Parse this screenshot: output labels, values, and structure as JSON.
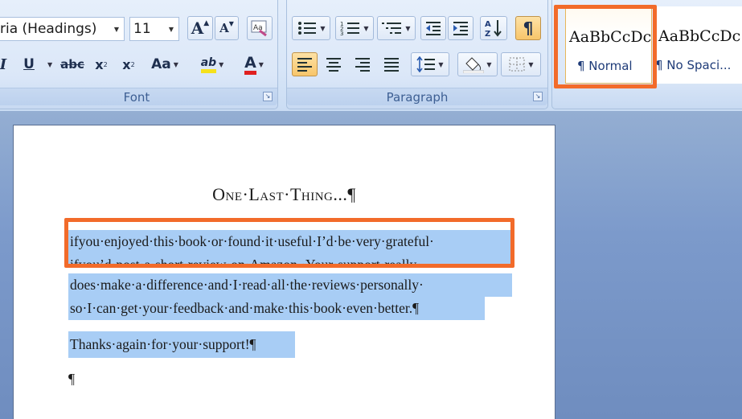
{
  "font_group": {
    "font_name": "ria (Headings)",
    "font_size": "11",
    "label": "Font",
    "buttons": {
      "grow": "A",
      "shrink": "A",
      "italic": "I",
      "underline": "U",
      "strike": "abc",
      "subscript": "x",
      "superscript": "x",
      "change_case": "Aa",
      "highlight": "ab",
      "font_color": "A"
    },
    "colors": {
      "highlight": "#f5e11c",
      "font_color": "#e02020"
    }
  },
  "paragraph_group": {
    "label": "Paragraph",
    "buttons": {
      "show_marks": "¶"
    }
  },
  "styles_group": {
    "styles": [
      {
        "preview": "AaBbCcDc",
        "name": "¶ Normal"
      },
      {
        "preview": "AaBbCcDc",
        "name": "¶ No Spaci..."
      }
    ]
  },
  "document": {
    "title": "One·Last·Thing...¶",
    "lines": [
      "ifyou·enjoyed·this·book·or·found·it·useful·I’d·be·very·grateful·",
      "ifyou’d·post·a·short·review·on·Amazon.·Your·support·really·",
      "does·make·a·difference·and·I·read·all·the·reviews·personally·",
      "so·I·can·get·your·feedback·and·make·this·book·even·better.¶",
      "Thanks·again·for·your·support!¶",
      "¶"
    ]
  },
  "annotation_color": "#f26b2a"
}
